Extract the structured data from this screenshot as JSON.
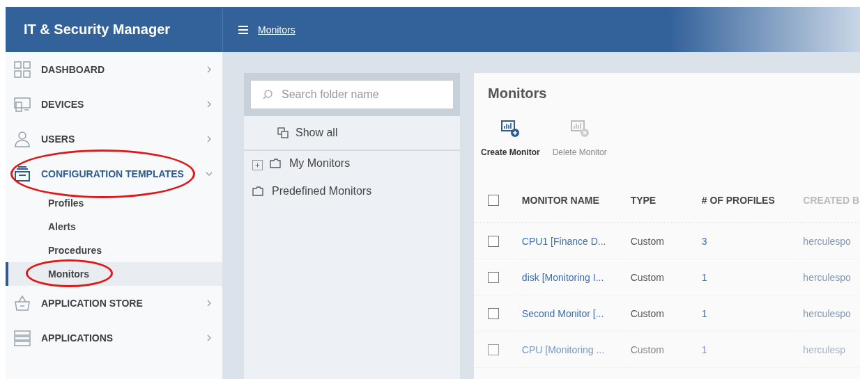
{
  "app": {
    "title": "IT & Security Manager"
  },
  "header": {
    "breadcrumb": "Monitors"
  },
  "sidebar": {
    "items": [
      {
        "label": "DASHBOARD",
        "expanded": false,
        "circled": false
      },
      {
        "label": "DEVICES",
        "expanded": false,
        "circled": false
      },
      {
        "label": "USERS",
        "expanded": false,
        "circled": false
      },
      {
        "label": "CONFIGURATION TEMPLATES",
        "expanded": true,
        "circled": true,
        "children": [
          {
            "label": "Profiles",
            "selected": false,
            "circled": false
          },
          {
            "label": "Alerts",
            "selected": false,
            "circled": false
          },
          {
            "label": "Procedures",
            "selected": false,
            "circled": false
          },
          {
            "label": "Monitors",
            "selected": true,
            "circled": true
          }
        ]
      },
      {
        "label": "APPLICATION STORE",
        "expanded": false,
        "circled": false
      },
      {
        "label": "APPLICATIONS",
        "expanded": false,
        "circled": false
      }
    ]
  },
  "folders": {
    "search": {
      "placeholder": "Search folder name"
    },
    "show_all": "Show all",
    "tree": [
      {
        "label": "My Monitors",
        "expandable": true
      },
      {
        "label": "Predefined Monitors",
        "expandable": false
      }
    ]
  },
  "content": {
    "title": "Monitors",
    "toolbar": [
      {
        "label": "Create Monitor",
        "disabled": false
      },
      {
        "label": "Delete Monitor",
        "disabled": true
      }
    ],
    "table": {
      "all_checked": false,
      "columns": [
        "MONITOR NAME",
        "TYPE",
        "# OF PROFILES",
        "CREATED B"
      ],
      "rows": [
        {
          "checked": false,
          "name": "CPU1 [Finance D...",
          "type": "Custom",
          "profiles": "3",
          "created_by": "herculespo"
        },
        {
          "checked": false,
          "name": "disk [Monitoring I...",
          "type": "Custom",
          "profiles": "1",
          "created_by": "herculespo"
        },
        {
          "checked": false,
          "name": "Second Monitor [...",
          "type": "Custom",
          "profiles": "1",
          "created_by": "herculespo"
        },
        {
          "checked": false,
          "name": "CPU [Monitoring ...",
          "type": "Custom",
          "profiles": "1",
          "created_by": "herculesp"
        }
      ]
    }
  }
}
